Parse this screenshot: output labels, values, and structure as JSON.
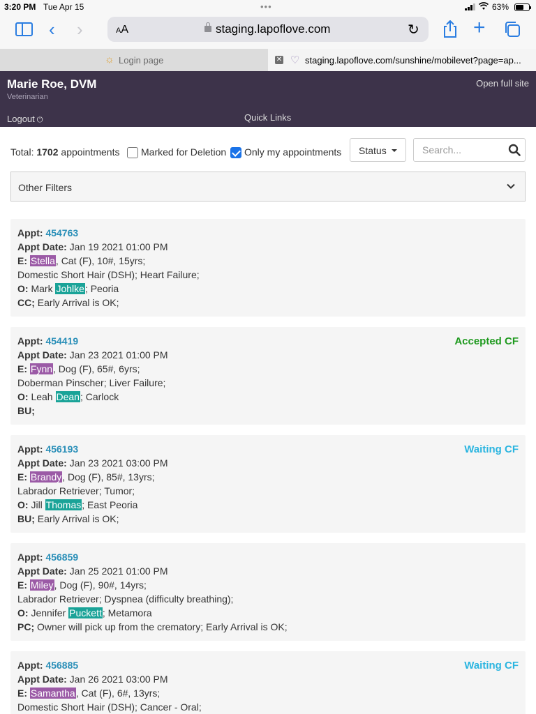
{
  "statusbar": {
    "time": "3:20 PM",
    "date": "Tue Apr 15",
    "battery_text": "63%",
    "battery_level": 0.63
  },
  "browser": {
    "aa_label": "AA",
    "url": "staging.lapoflove.com",
    "tabs": [
      {
        "title": "Login page",
        "active": false
      },
      {
        "title": "staging.lapoflove.com/sunshine/mobilevet?page=ap...",
        "active": true
      }
    ]
  },
  "header": {
    "name": "Marie Roe, DVM",
    "role": "Veterinarian",
    "open_full_site": "Open full site",
    "logout": "Logout",
    "quick_links": "Quick Links"
  },
  "filters": {
    "total_label": "Total:",
    "total_count": "1702",
    "total_suffix": "appointments",
    "marked_for_deletion": "Marked for Deletion",
    "marked_for_deletion_checked": false,
    "only_mine": "Only my appointments",
    "only_mine_checked": true,
    "status_label": "Status",
    "search_placeholder": "Search...",
    "other_filters": "Other Filters"
  },
  "appointments": [
    {
      "appt_label": "Appt:",
      "appt_no": "454763",
      "date_label": "Appt Date:",
      "date": "Jan 19 2021 01:00 PM",
      "e_label": "E:",
      "pet": "Stella",
      "pet_info": ", Cat (F), 10#, 15yrs;",
      "breed_line": "Domestic Short Hair (DSH); Heart Failure;",
      "o_label": "O:",
      "owner_first": "Mark",
      "owner_last": "Johlke",
      "owner_city": "; Peoria",
      "code": "CC;",
      "code_note": "Early Arrival is OK;",
      "status": ""
    },
    {
      "appt_label": "Appt:",
      "appt_no": "454419",
      "date_label": "Appt Date:",
      "date": "Jan 23 2021 01:00 PM",
      "e_label": "E:",
      "pet": "Fynn",
      "pet_info": ", Dog (F), 65#, 6yrs;",
      "breed_line": "Doberman Pinscher; Liver Failure;",
      "o_label": "O:",
      "owner_first": "Leah",
      "owner_last": "Dean",
      "owner_city": "; Carlock",
      "code": "BU;",
      "code_note": "",
      "status": "Accepted CF"
    },
    {
      "appt_label": "Appt:",
      "appt_no": "456193",
      "date_label": "Appt Date:",
      "date": "Jan 23 2021 03:00 PM",
      "e_label": "E:",
      "pet": "Brandy",
      "pet_info": ", Dog (F), 85#, 13yrs;",
      "breed_line": "Labrador Retriever; Tumor;",
      "o_label": "O:",
      "owner_first": "Jill",
      "owner_last": "Thomas",
      "owner_city": "; East Peoria",
      "code": "BU;",
      "code_note": "Early Arrival is OK;",
      "status": "Waiting CF"
    },
    {
      "appt_label": "Appt:",
      "appt_no": "456859",
      "date_label": "Appt Date:",
      "date": "Jan 25 2021 01:00 PM",
      "e_label": "E:",
      "pet": "Miley",
      "pet_info": ", Dog (F), 90#, 14yrs;",
      "breed_line": "Labrador Retriever; Dyspnea (difficulty breathing);",
      "o_label": "O:",
      "owner_first": "Jennifer",
      "owner_last": "Puckett",
      "owner_city": "; Metamora",
      "code": "PC;",
      "code_note": "Owner will pick up from the crematory; Early Arrival is OK;",
      "status": ""
    },
    {
      "appt_label": "Appt:",
      "appt_no": "456885",
      "date_label": "Appt Date:",
      "date": "Jan 26 2021 03:00 PM",
      "e_label": "E:",
      "pet": "Samantha",
      "pet_info": ", Cat (F), 6#, 13yrs;",
      "breed_line": "Domestic Short Hair (DSH); Cancer - Oral;",
      "o_label": "",
      "owner_first": "",
      "owner_last": "",
      "owner_city": "",
      "code": "",
      "code_note": "",
      "status": "Waiting CF"
    }
  ],
  "colors": {
    "header_bg": "#3d334a",
    "pet_highlight": "#9b5aa6",
    "owner_highlight": "#1aa398",
    "link": "#2a8fb8",
    "accepted": "#1f9a1f",
    "waiting": "#2bb5e0"
  }
}
